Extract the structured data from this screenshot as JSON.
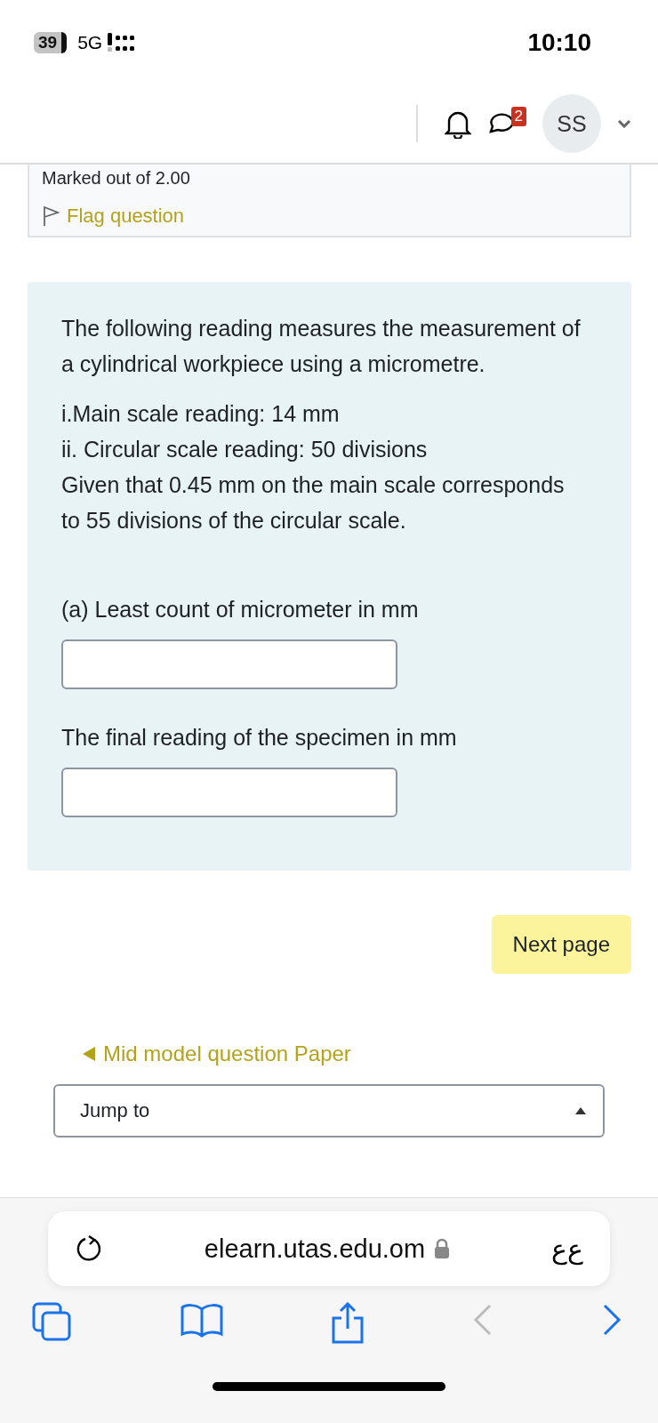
{
  "status_bar": {
    "battery": "39",
    "network": "5G",
    "time": "10:10"
  },
  "header": {
    "message_count": "2",
    "avatar": "SS"
  },
  "question_info": {
    "marks": "Marked out of 2.00",
    "flag_label": "Flag question",
    "flagged": false
  },
  "question": {
    "paragraphs": [
      "The following reading measures the measurement of a cylindrical workpiece using a micrometre.",
      "i.Main scale reading: 14 mm\nii. Circular scale reading: 50 divisions\nGiven that 0.45 mm on the main scale corresponds to 55 divisions of the circular scale."
    ],
    "parts": [
      {
        "label": "(a) Least count of micrometer in mm"
      },
      {
        "label": "The final reading of the specimen in mm"
      }
    ]
  },
  "next_button": "Next page",
  "prev_link": "Mid model question Paper",
  "jump_select": "Jump to",
  "browser": {
    "url": "elearn.utas.edu.om",
    "text_size": "ﻉﻉ"
  }
}
